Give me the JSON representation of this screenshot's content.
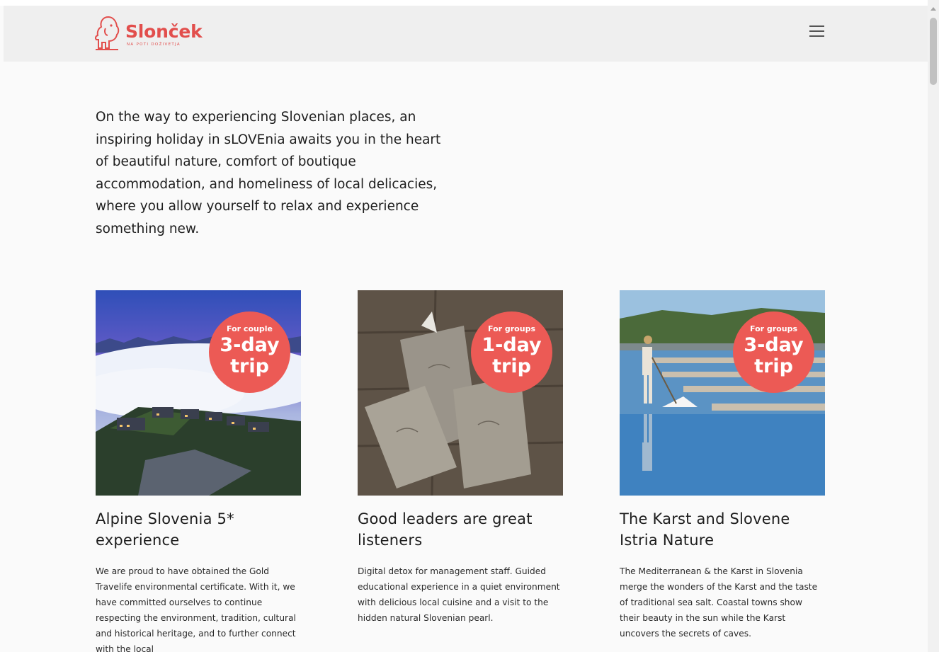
{
  "header": {
    "logo_name": "Slonček",
    "logo_tagline": "NA POTI DOŽIVETJA",
    "menu_icon": "hamburger-menu-icon"
  },
  "intro": {
    "text": "On the way to experiencing Slovenian places, an inspiring holiday in sLOVEnia awaits you in the heart of beautiful nature, comfort of boutique accommodation, and homeliness of local delicacies, where you allow yourself to relax and experience something new."
  },
  "cards": [
    {
      "badge_audience": "For couple",
      "badge_days": "3-day",
      "badge_trip": "trip",
      "title": "Alpine Slovenia 5* experience",
      "text": "We are proud to have obtained the Gold Travelife environmental certificate. With it, we have committed ourselves to continue respecting the environment, tradition, cultural and historical heritage, and to further connect with the local"
    },
    {
      "badge_audience": "For groups",
      "badge_days": "1-day",
      "badge_trip": "trip",
      "title": "Good leaders are great listeners",
      "text": "Digital detox for management staff. Guided educational experience in a quiet environment with delicious local cuisine and a visit to the hidden natural Slovenian pearl."
    },
    {
      "badge_audience": "For groups",
      "badge_days": "3-day",
      "badge_trip": "trip",
      "title": "The Karst and Slovene Istria Nature",
      "text": "The Mediterranean & the Karst in Slovenia merge the wonders of the Karst and the taste of traditional sea salt. Coastal towns show their beauty in the sun while the Karst uncovers the secrets of caves."
    }
  ],
  "colors": {
    "brand": "#e24e4c",
    "badge": "#ec5a55",
    "header_bg": "#efefef",
    "page_bg": "#fafafa"
  }
}
